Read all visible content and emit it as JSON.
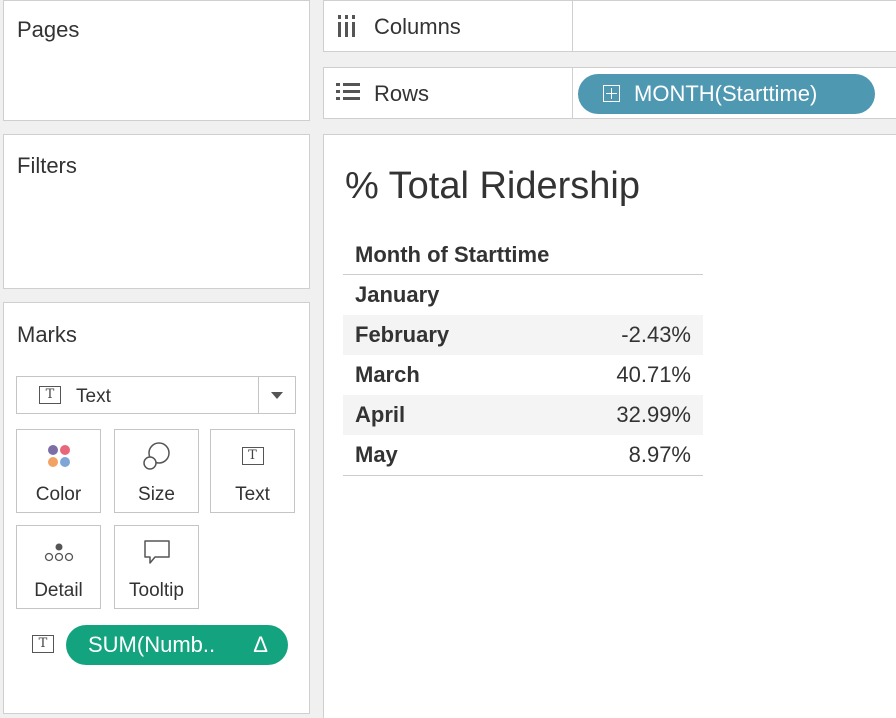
{
  "cards": {
    "pages": "Pages",
    "filters": "Filters",
    "marks": "Marks"
  },
  "marks": {
    "type": "Text",
    "buttons": {
      "color": "Color",
      "size": "Size",
      "text": "Text",
      "detail": "Detail",
      "tooltip": "Tooltip"
    },
    "field_pill": "SUM(Numb..",
    "field_pill_delta": "Δ",
    "field_pill_color": "#14a37f"
  },
  "shelves": {
    "columns": "Columns",
    "rows": "Rows",
    "rows_pill": "MONTH(Starttime)",
    "rows_pill_color": "#4e98b2"
  },
  "viz": {
    "title": "% Total Ridership",
    "header": "Month of Starttime",
    "rows": [
      {
        "month": "January",
        "value": ""
      },
      {
        "month": "February",
        "value": "-2.43%"
      },
      {
        "month": "March",
        "value": "40.71%"
      },
      {
        "month": "April",
        "value": "32.99%"
      },
      {
        "month": "May",
        "value": "8.97%"
      }
    ]
  }
}
